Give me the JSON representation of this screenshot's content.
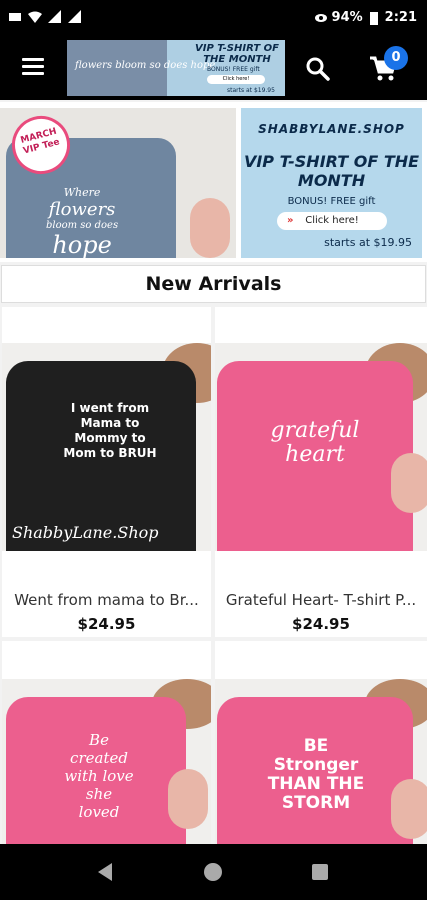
{
  "status_bar": {
    "battery": "94%",
    "time": "2:21"
  },
  "app_bar": {
    "menu_icon": "hamburger-menu-icon",
    "logo": {
      "shirt_text": "flowers bloom so does hope",
      "headline": "VIP T-SHIRT OF THE MONTH",
      "bonus": "BONUS! FREE gift",
      "button": "Click here!",
      "price": "starts at $19.95"
    },
    "search_icon": "search-icon",
    "cart_icon": "shopping-cart-icon",
    "cart_count": "0"
  },
  "hero": {
    "badge": "MARCH VIP Tee",
    "shirt_text_1": "Where",
    "shirt_text_2": "flowers",
    "shirt_text_3": "bloom so does",
    "shirt_text_4": "hope",
    "site": "SHABBYLANE.SHOP",
    "title": "VIP T-SHIRT OF THE MONTH",
    "bonus": "BONUS!  FREE gift",
    "button": "Click here!",
    "price": "starts at $19.95"
  },
  "section_title": "New Arrivals",
  "products": [
    {
      "name": "Went from mama to Br...",
      "price": "$24.95",
      "print": "I went from Mama to Mommy to Mom to BRUH",
      "watermark": "ShabbyLane.Shop",
      "shirt_color": "#1f1f1f"
    },
    {
      "name": "Grateful Heart- T-shirt P...",
      "price": "$24.95",
      "print": "grateful heart",
      "shirt_color": "#ec5f8e"
    },
    {
      "name": "",
      "price": "",
      "print": "Be created with love she loved",
      "shirt_color": "#ec5f8e"
    },
    {
      "name": "",
      "price": "",
      "print": "BE Stronger THAN THE STORM",
      "shirt_color": "#ec5f8e"
    }
  ],
  "nav": {
    "back": "back-icon",
    "home": "home-icon",
    "recents": "recents-icon"
  }
}
